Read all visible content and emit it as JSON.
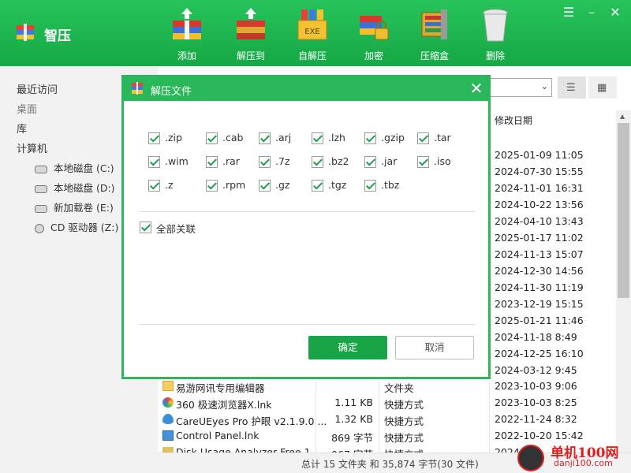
{
  "app": {
    "title": "智压"
  },
  "toolbar": [
    {
      "label": "添加",
      "icon": "add-archive-icon"
    },
    {
      "label": "解压到",
      "icon": "extract-to-icon"
    },
    {
      "label": "自解压",
      "icon": "self-extract-exe-icon"
    },
    {
      "label": "加密",
      "icon": "encrypt-lock-icon"
    },
    {
      "label": "压缩盒",
      "icon": "compress-box-icon"
    },
    {
      "label": "删除",
      "icon": "trash-icon"
    }
  ],
  "sidebar": {
    "items": [
      "最近访问",
      "桌面",
      "库",
      "计算机"
    ],
    "drives": [
      "本地磁盘 (C:)",
      "本地磁盘 (D:)",
      "新加载卷 (E:)",
      "CD 驱动器 (Z:)"
    ]
  },
  "filelist": {
    "date_header": "修改日期",
    "visible_dates": [
      "2025-01-09 11:05",
      "2024-07-30 15:55",
      "2024-11-01 16:31",
      "2024-10-22 13:56",
      "2024-04-10 13:43",
      "2025-01-17 11:02",
      "2024-11-13 15:07",
      "2024-12-30 14:56",
      "2024-11-30 11:19",
      "2023-12-19 15:15",
      "2025-01-21 11:46",
      "2024-11-18 8:49",
      "2024-12-25 16:10",
      "2024-03-12 9:45"
    ],
    "rows": [
      {
        "name": "易游网讯专用编辑器",
        "size": "",
        "type": "文件夹",
        "date": "2023-10-03 9:06",
        "icon": "folder-icon"
      },
      {
        "name": "360 极速浏览器X.lnk",
        "size": "1.11 KB",
        "type": "快捷方式",
        "date": "2023-10-03 8:25",
        "icon": "browser-360-icon"
      },
      {
        "name": "CareUEyes Pro 护眼 v2.1.9.0 ...",
        "size": "1.32 KB",
        "type": "快捷方式",
        "date": "2022-11-24 8:32",
        "icon": "eye-icon"
      },
      {
        "name": "Control Panel.lnk",
        "size": "869 字节",
        "type": "快捷方式",
        "date": "2022-10-20 15:42",
        "icon": "control-panel-icon"
      },
      {
        "name": "Disk Usage Analyzer Free 1...",
        "size": "967 字节",
        "type": "快捷方式",
        "date": "2024...",
        "icon": "disk-usage-icon"
      }
    ]
  },
  "status": {
    "text": "总计 15 文件夹 和 35,874 字节(30 文件)"
  },
  "watermark": {
    "text": "单机100网",
    "sub": "danji100.com"
  },
  "dialog": {
    "title": "解压文件",
    "extensions": [
      ".zip",
      ".cab",
      ".arj",
      ".lzh",
      ".gzip",
      ".tar",
      ".wim",
      ".rar",
      ".7z",
      ".bz2",
      ".jar",
      ".iso",
      ".z",
      ".rpm",
      ".gz",
      ".tgz",
      ".tbz"
    ],
    "associate_all": "全部关联",
    "ok": "确定",
    "cancel": "取消"
  },
  "colors": {
    "accent": "#18a447",
    "titlebar": "#2ab75a"
  }
}
